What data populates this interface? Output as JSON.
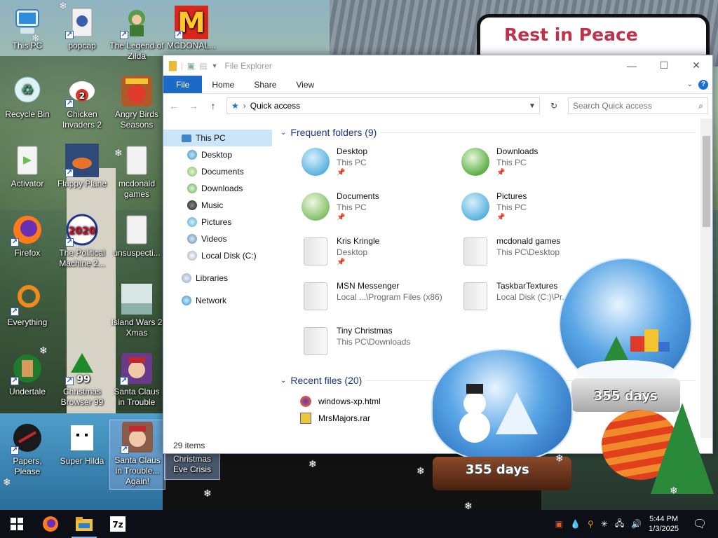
{
  "wallpaper": {
    "sign_text": "Rest in Peace"
  },
  "desktop_icons": [
    {
      "label": "This PC"
    },
    {
      "label": "popcap"
    },
    {
      "label": "The Legend of Zilda"
    },
    {
      "label": "MCDONAL..."
    },
    {
      "label": "Recycle Bin"
    },
    {
      "label": "Chicken Invaders 2"
    },
    {
      "label": "Angry Birds Seasons"
    },
    {
      "label": "Activator"
    },
    {
      "label": "Flappy Plane"
    },
    {
      "label": "mcdonald games"
    },
    {
      "label": "Firefox"
    },
    {
      "label": "The Political Machine 2..."
    },
    {
      "label": "unsuspecti..."
    },
    {
      "label": "Everything"
    },
    {
      "label": "Island Wars 2 Xmas"
    },
    {
      "label": "Undertale"
    },
    {
      "label": "Christmas Browser 99"
    },
    {
      "label": "Santa Claus in Trouble"
    },
    {
      "label": "Papers, Please"
    },
    {
      "label": "Super Hilda"
    },
    {
      "label": "Santa Claus in Trouble... Again!"
    },
    {
      "label": "Christmas Eve Crisis"
    }
  ],
  "explorer": {
    "title": "File Explorer",
    "tabs": [
      "File",
      "Home",
      "Share",
      "View"
    ],
    "address": "Quick access",
    "search_placeholder": "Search Quick access",
    "nav": {
      "this_pc": "This PC",
      "items": [
        "Desktop",
        "Documents",
        "Downloads",
        "Music",
        "Pictures",
        "Videos",
        "Local Disk (C:)"
      ],
      "libraries": "Libraries",
      "network": "Network"
    },
    "frequent_header": "Frequent folders (9)",
    "frequent": [
      {
        "name": "Desktop",
        "loc": "This PC"
      },
      {
        "name": "Downloads",
        "loc": "This PC"
      },
      {
        "name": "Documents",
        "loc": "This PC"
      },
      {
        "name": "Pictures",
        "loc": "This PC"
      },
      {
        "name": "Kris Kringle",
        "loc": "Desktop"
      },
      {
        "name": "mcdonald games",
        "loc": "This PC\\Desktop"
      },
      {
        "name": "MSN Messenger",
        "loc": "Local ...\\Program Files (x86)"
      },
      {
        "name": "TaskbarTextures",
        "loc": "Local Disk (C:)\\Pr..."
      },
      {
        "name": "Tiny Christmas",
        "loc": "This PC\\Downloads"
      }
    ],
    "recent_header": "Recent files (20)",
    "recent": [
      {
        "name": "windows-xp.html"
      },
      {
        "name": "MrsMajors.rar"
      }
    ],
    "status": "29 items"
  },
  "globes": {
    "label": "355 days"
  },
  "taskbar": {
    "time": "5:44 PM",
    "date": "1/3/2025"
  },
  "colors": {
    "accent": "#1b6ac7",
    "group_header": "#1e3287",
    "taskbar": "#0c0f16"
  }
}
